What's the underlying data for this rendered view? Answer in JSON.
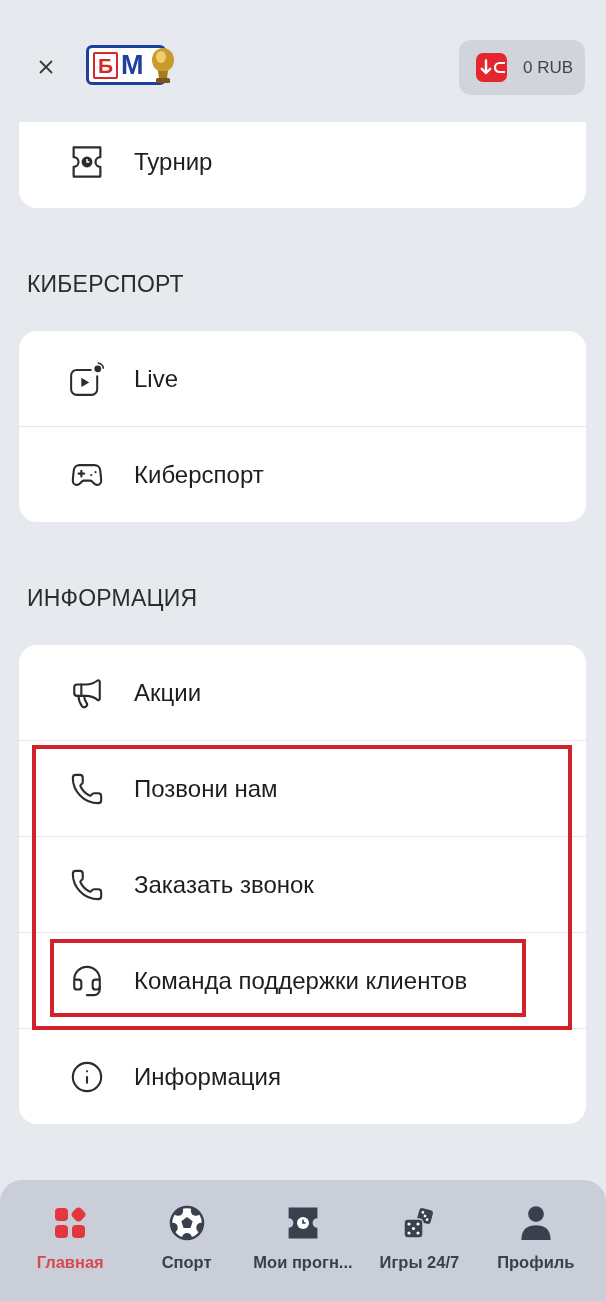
{
  "header": {
    "logo": [
      "Б",
      "М"
    ],
    "balance": "0 RUB"
  },
  "sections": [
    {
      "items": [
        {
          "label": "Турнир",
          "highlighted": false,
          "boxed": false
        }
      ]
    },
    {
      "title": "КИБЕРСПОРТ",
      "items": [
        {
          "label": "Live",
          "highlighted": false,
          "boxed": false
        },
        {
          "label": "Киберспорт",
          "highlighted": false,
          "boxed": false
        }
      ]
    },
    {
      "title": "ИНФОРМАЦИЯ",
      "items": [
        {
          "label": "Акции",
          "highlighted": false,
          "boxed": false
        },
        {
          "label": "Позвони нам",
          "highlighted": true,
          "boxed": false
        },
        {
          "label": "Заказать звонок",
          "highlighted": true,
          "boxed": false
        },
        {
          "label": "Команда поддержки клиентов",
          "highlighted": true,
          "boxed": true
        },
        {
          "label": "Информация",
          "highlighted": false,
          "boxed": false
        }
      ]
    }
  ],
  "nav": [
    {
      "label": "Главная",
      "selected": true
    },
    {
      "label": "Спорт",
      "selected": false
    },
    {
      "label": "Мои прогн...",
      "selected": false
    },
    {
      "label": "Игры 24/7",
      "selected": false
    },
    {
      "label": "Профиль",
      "selected": false
    }
  ]
}
